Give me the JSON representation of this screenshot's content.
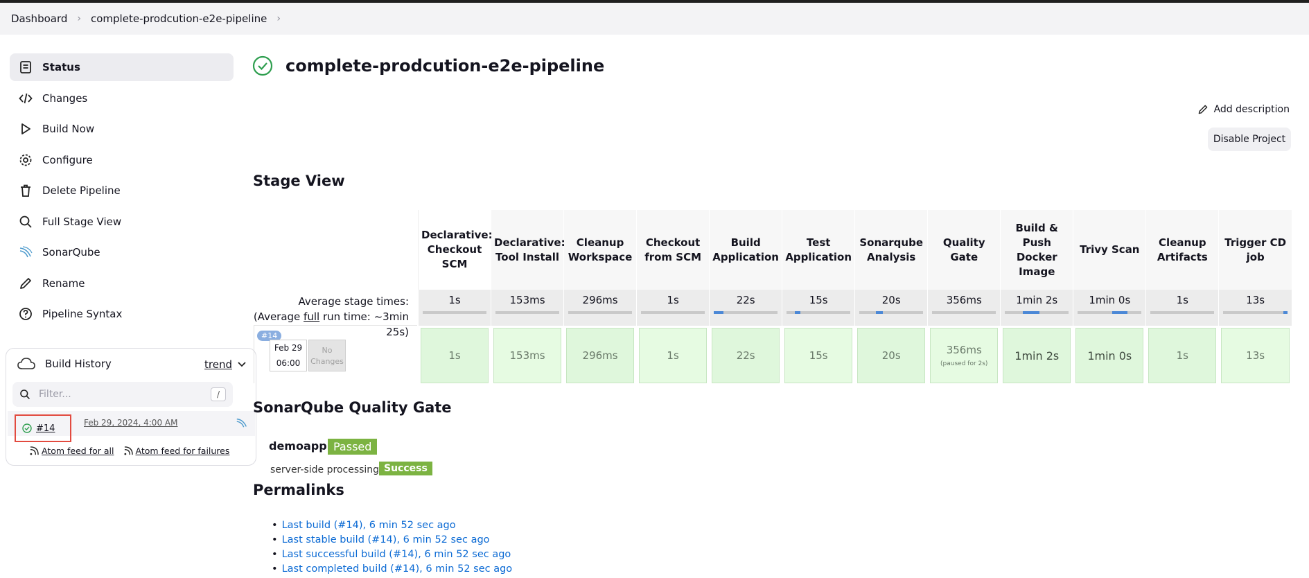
{
  "breadcrumb": [
    "Dashboard",
    "complete-prodcution-e2e-pipeline"
  ],
  "sidebar": {
    "items": [
      {
        "label": "Status",
        "icon": "status-icon"
      },
      {
        "label": "Changes",
        "icon": "code-icon"
      },
      {
        "label": "Build Now",
        "icon": "play-icon"
      },
      {
        "label": "Configure",
        "icon": "gear-icon"
      },
      {
        "label": "Delete Pipeline",
        "icon": "trash-icon"
      },
      {
        "label": "Full Stage View",
        "icon": "search-icon"
      },
      {
        "label": "SonarQube",
        "icon": "sonarqube-icon"
      },
      {
        "label": "Rename",
        "icon": "pencil-icon"
      },
      {
        "label": "Pipeline Syntax",
        "icon": "help-icon"
      }
    ]
  },
  "build_history": {
    "title": "Build History",
    "trend": "trend",
    "filter_placeholder": "Filter...",
    "filter_shortcut": "/",
    "builds": [
      {
        "number": "#14",
        "date": "Feb 29, 2024, 4:00 AM",
        "status": "success"
      }
    ],
    "feed_all": "Atom feed for all",
    "feed_failures": "Atom feed for failures"
  },
  "project": {
    "title": "complete-prodcution-e2e-pipeline",
    "add_description": "Add description",
    "disable_button": "Disable Project"
  },
  "stage_view": {
    "heading": "Stage View",
    "avg_label": "Average stage times:",
    "avg_full_prefix": "(Average ",
    "avg_full_word": "full",
    "avg_full_suffix": " run time: ~3min 25s)",
    "run": {
      "badge": "#14",
      "date": "Feb 29",
      "time": "06:00",
      "no_changes": "No Changes"
    },
    "stages": [
      {
        "name": "Declarative: Checkout SCM",
        "avg": "1s",
        "run": "1s"
      },
      {
        "name": "Declarative: Tool Install",
        "avg": "153ms",
        "run": "153ms"
      },
      {
        "name": "Cleanup Workspace",
        "avg": "296ms",
        "run": "296ms"
      },
      {
        "name": "Checkout from SCM",
        "avg": "1s",
        "run": "1s"
      },
      {
        "name": "Build Application",
        "avg": "22s",
        "run": "22s"
      },
      {
        "name": "Test Application",
        "avg": "15s",
        "run": "15s"
      },
      {
        "name": "Sonarqube Analysis",
        "avg": "20s",
        "run": "20s"
      },
      {
        "name": "Quality Gate",
        "avg": "356ms",
        "run": "356ms",
        "note": "(paused for 2s)"
      },
      {
        "name": "Build & Push Docker Image",
        "avg": "1min 2s",
        "run": "1min 2s"
      },
      {
        "name": "Trivy Scan",
        "avg": "1min 0s",
        "run": "1min 0s"
      },
      {
        "name": "Cleanup Artifacts",
        "avg": "1s",
        "run": "1s"
      },
      {
        "name": "Trigger CD job",
        "avg": "13s",
        "run": "13s"
      }
    ]
  },
  "sonarqube": {
    "heading": "SonarQube Quality Gate",
    "project": "demoapp",
    "status": "Passed",
    "ssp_label": "server-side processing:",
    "ssp_status": "Success"
  },
  "permalinks": {
    "heading": "Permalinks",
    "links": [
      "Last build (#14), 6 min 52 sec ago",
      "Last stable build (#14), 6 min 52 sec ago",
      "Last successful build (#14), 6 min 52 sec ago",
      "Last completed build (#14), 6 min 52 sec ago"
    ]
  },
  "colors": {
    "success": "#2e9e4f",
    "passed_badge": "#7cb342",
    "link": "#0b6ad4"
  }
}
